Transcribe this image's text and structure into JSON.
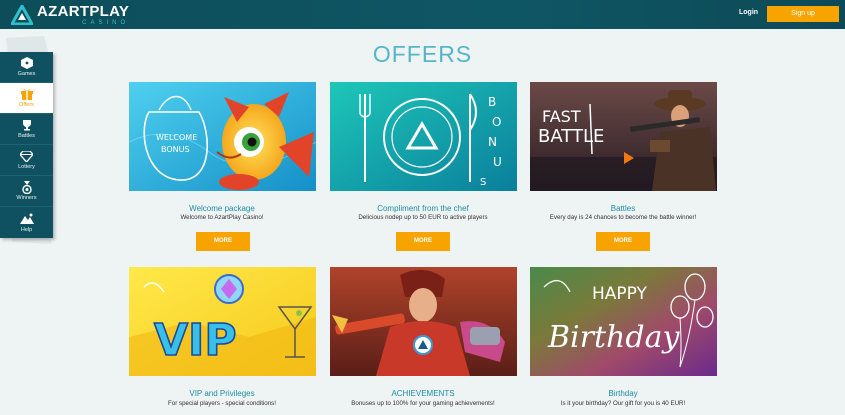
{
  "header": {
    "logo_name": "AZARTPLAY",
    "logo_sub": "CASINO",
    "login_label": "Login",
    "signup_label": "Sign up"
  },
  "sidebar": {
    "items": [
      {
        "label": "Games",
        "icon": "dice-icon"
      },
      {
        "label": "Offers",
        "icon": "gift-icon",
        "active": true
      },
      {
        "label": "Battles",
        "icon": "trophy-icon"
      },
      {
        "label": "Lottery",
        "icon": "diamond-icon"
      },
      {
        "label": "Winners",
        "icon": "medal-icon"
      },
      {
        "label": "Help",
        "icon": "help-icon"
      }
    ]
  },
  "page": {
    "title": "OFFERS"
  },
  "offers": [
    {
      "title": "Welcome package",
      "desc": "Welcome to AzartPlay Casino!",
      "button": "MORE",
      "image": {
        "sack_line1": "WELCOME",
        "sack_line2": "BONUS"
      }
    },
    {
      "title": "Compliment from the chef",
      "desc": "Delicious nodep up to 50 EUR to active players",
      "button": "MORE",
      "image": {
        "letters": [
          "B",
          "O",
          "N",
          "U",
          "S"
        ]
      }
    },
    {
      "title": "Battles",
      "desc": "Every day is 24 chances to become the battle winner!",
      "button": "MORE",
      "image": {
        "line1": "FAST",
        "line2": "BATTLE"
      }
    },
    {
      "title": "VIP and Privileges",
      "desc": "For special players - special conditions!",
      "image": {
        "text": "VIP"
      }
    },
    {
      "title": "ACHIEVEMENTS",
      "desc": "Bonuses up to 100% for your gaming achievements!",
      "image": {}
    },
    {
      "title": "Birthday",
      "desc": "Is it your birthday? Our gift for you is 40 EUR!",
      "image": {
        "line1": "HAPPY",
        "line2": "Birthday"
      }
    }
  ],
  "colors": {
    "header_bg": "#0f5664",
    "accent_orange": "#f7a400",
    "title_teal": "#55b6c8",
    "card_title": "#1e8ea3"
  }
}
